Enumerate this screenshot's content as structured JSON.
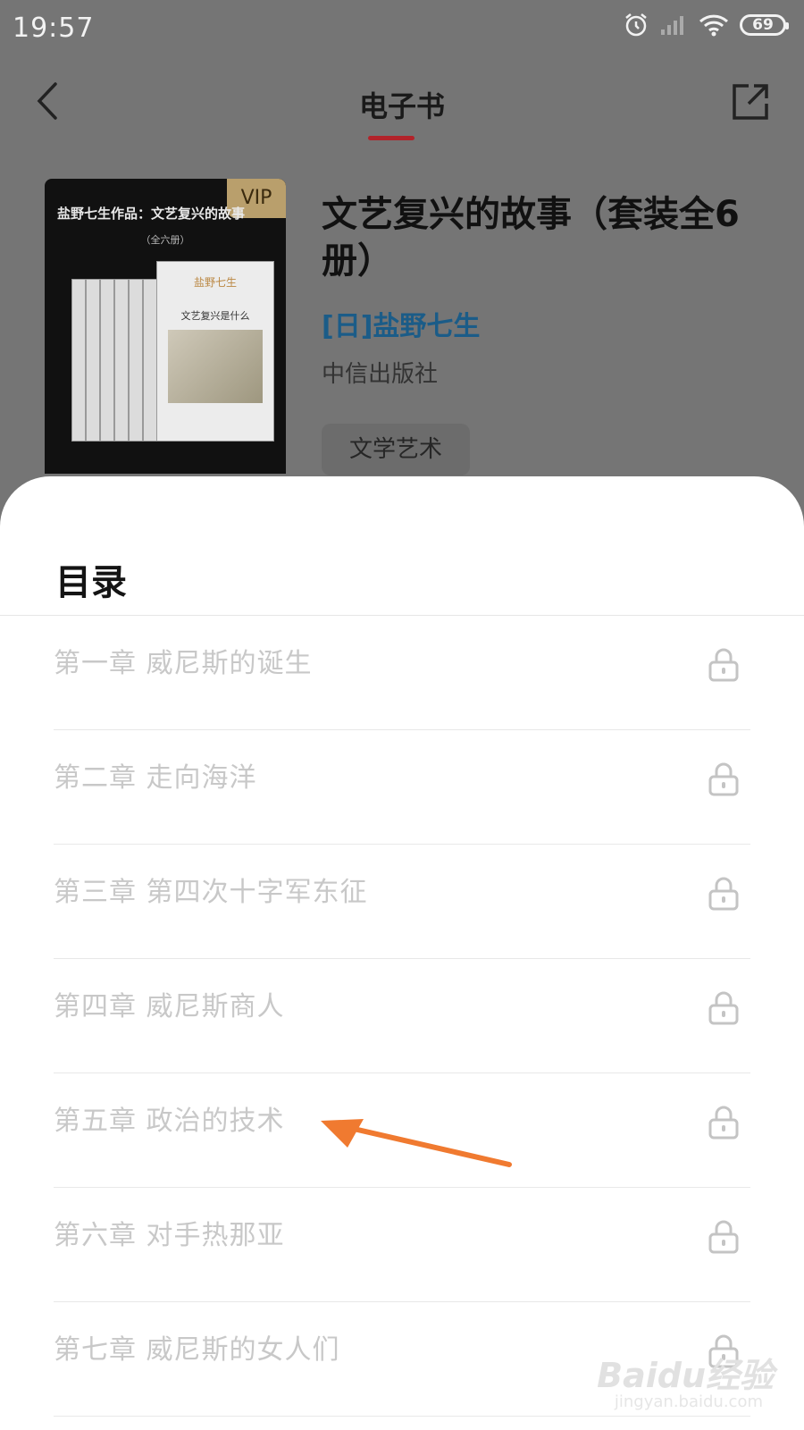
{
  "status_bar": {
    "time": "19:57",
    "battery": "69"
  },
  "header": {
    "title": "电子书"
  },
  "book": {
    "vip_badge": "VIP",
    "cover_title": "盐野七生作品：文艺复兴的故事",
    "cover_subtitle": "（全六册）",
    "cover_author": "盐野七生",
    "cover_book_name": "文艺复兴是什么",
    "title": "文艺复兴的故事（套装全6册）",
    "author": "[日]盐野七生",
    "publisher": "中信出版社",
    "tag": "文学艺术"
  },
  "toc": {
    "title": "目录",
    "chapters": [
      "第一章 威尼斯的诞生",
      "第二章 走向海洋",
      "第三章 第四次十字军东征",
      "第四章 威尼斯商人",
      "第五章 政治的技术",
      "第六章 对手热那亚",
      "第七章 威尼斯的女人们"
    ]
  },
  "annotation": {
    "arrow_color": "#f07a30"
  },
  "watermark": {
    "main": "Baidu经验",
    "sub": "jingyan.baidu.com"
  }
}
